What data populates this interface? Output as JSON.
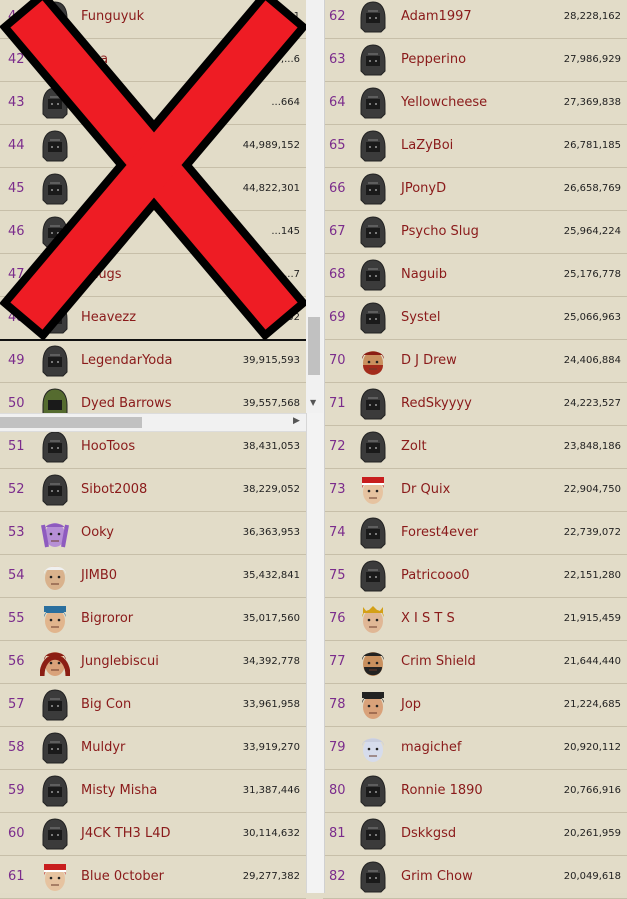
{
  "left_rows": [
    {
      "rank": "41",
      "name": "Funguyuk",
      "score": "47,471,191",
      "avatar": "helm"
    },
    {
      "rank": "42",
      "name": "...sa",
      "score": "47,...6",
      "avatar": "helm"
    },
    {
      "rank": "43",
      "name": "",
      "score": "...664",
      "avatar": "helm"
    },
    {
      "rank": "44",
      "name": "",
      "score": "44,989,152",
      "avatar": "helm"
    },
    {
      "rank": "45",
      "name": "",
      "score": "44,822,301",
      "avatar": "helm"
    },
    {
      "rank": "46",
      "name": "",
      "score": "...145",
      "avatar": "helm"
    },
    {
      "rank": "47",
      "name": "Chugs",
      "score": "...7",
      "avatar": "helm"
    },
    {
      "rank": "48",
      "name": "Heavezz",
      "score": "...592,102",
      "avatar": "helm"
    },
    {
      "rank": "49",
      "name": "LegendarYoda",
      "score": "39,915,593",
      "avatar": "helm"
    },
    {
      "rank": "50",
      "name": "Dyed Barrows",
      "score": "39,557,568",
      "avatar": "green-helm"
    },
    {
      "rank": "51",
      "name": "HooToos",
      "score": "38,431,053",
      "avatar": "helm"
    },
    {
      "rank": "52",
      "name": "Sibot2008",
      "score": "38,229,052",
      "avatar": "helm"
    },
    {
      "rank": "53",
      "name": "Ooky",
      "score": "36,363,953",
      "avatar": "purple-face"
    },
    {
      "rank": "54",
      "name": "JIMB0",
      "score": "35,432,841",
      "avatar": "white-hair-face"
    },
    {
      "rank": "55",
      "name": "Bigroror",
      "score": "35,017,560",
      "avatar": "blue-hat-face"
    },
    {
      "rank": "56",
      "name": "Junglebiscui",
      "score": "34,392,778",
      "avatar": "red-hood-face"
    },
    {
      "rank": "57",
      "name": "Big Con",
      "score": "33,961,958",
      "avatar": "helm"
    },
    {
      "rank": "58",
      "name": "Muldyr",
      "score": "33,919,270",
      "avatar": "helm"
    },
    {
      "rank": "59",
      "name": "Misty Misha",
      "score": "31,387,446",
      "avatar": "helm"
    },
    {
      "rank": "60",
      "name": "J4CK TH3 L4D",
      "score": "30,114,632",
      "avatar": "helm"
    },
    {
      "rank": "61",
      "name": "Blue 0ctober",
      "score": "29,277,382",
      "avatar": "santa-face"
    }
  ],
  "right_rows": [
    {
      "rank": "62",
      "name": "Adam1997",
      "score": "28,228,162",
      "avatar": "helm"
    },
    {
      "rank": "63",
      "name": "Pepperino",
      "score": "27,986,929",
      "avatar": "helm"
    },
    {
      "rank": "64",
      "name": "Yellowcheese",
      "score": "27,369,838",
      "avatar": "helm"
    },
    {
      "rank": "65",
      "name": "LaZyBoi",
      "score": "26,781,185",
      "avatar": "helm"
    },
    {
      "rank": "66",
      "name": "JPonyD",
      "score": "26,658,769",
      "avatar": "helm"
    },
    {
      "rank": "67",
      "name": "Psycho Slug",
      "score": "25,964,224",
      "avatar": "helm"
    },
    {
      "rank": "68",
      "name": "Naguib",
      "score": "25,176,778",
      "avatar": "helm"
    },
    {
      "rank": "69",
      "name": "Systel",
      "score": "25,066,963",
      "avatar": "helm"
    },
    {
      "rank": "70",
      "name": "D J Drew",
      "score": "24,406,884",
      "avatar": "red-beard-face"
    },
    {
      "rank": "71",
      "name": "RedSkyyyy",
      "score": "24,223,527",
      "avatar": "helm"
    },
    {
      "rank": "72",
      "name": "Zolt",
      "score": "23,848,186",
      "avatar": "helm"
    },
    {
      "rank": "73",
      "name": "Dr Quix",
      "score": "22,904,750",
      "avatar": "santa-face"
    },
    {
      "rank": "74",
      "name": "Forest4ever",
      "score": "22,739,072",
      "avatar": "helm"
    },
    {
      "rank": "75",
      "name": "Patricooo0",
      "score": "22,151,280",
      "avatar": "helm"
    },
    {
      "rank": "76",
      "name": "X I S T S",
      "score": "21,915,459",
      "avatar": "crown-face"
    },
    {
      "rank": "77",
      "name": "Crim Shield",
      "score": "21,644,440",
      "avatar": "dark-beard-face"
    },
    {
      "rank": "78",
      "name": "Jop",
      "score": "21,224,685",
      "avatar": "skull-hat-face"
    },
    {
      "rank": "79",
      "name": "magichef",
      "score": "20,920,112",
      "avatar": "pale-face"
    },
    {
      "rank": "80",
      "name": "Ronnie 1890",
      "score": "20,766,916",
      "avatar": "helm"
    },
    {
      "rank": "81",
      "name": "Dskkgsd",
      "score": "20,261,959",
      "avatar": "helm"
    },
    {
      "rank": "82",
      "name": "Grim Chow",
      "score": "20,049,618",
      "avatar": "helm"
    }
  ],
  "colors": {
    "rank": "#7b2c8c",
    "name": "#8a1a1a",
    "background": "#e2dcc8",
    "x_mark": "#ee1c24"
  }
}
